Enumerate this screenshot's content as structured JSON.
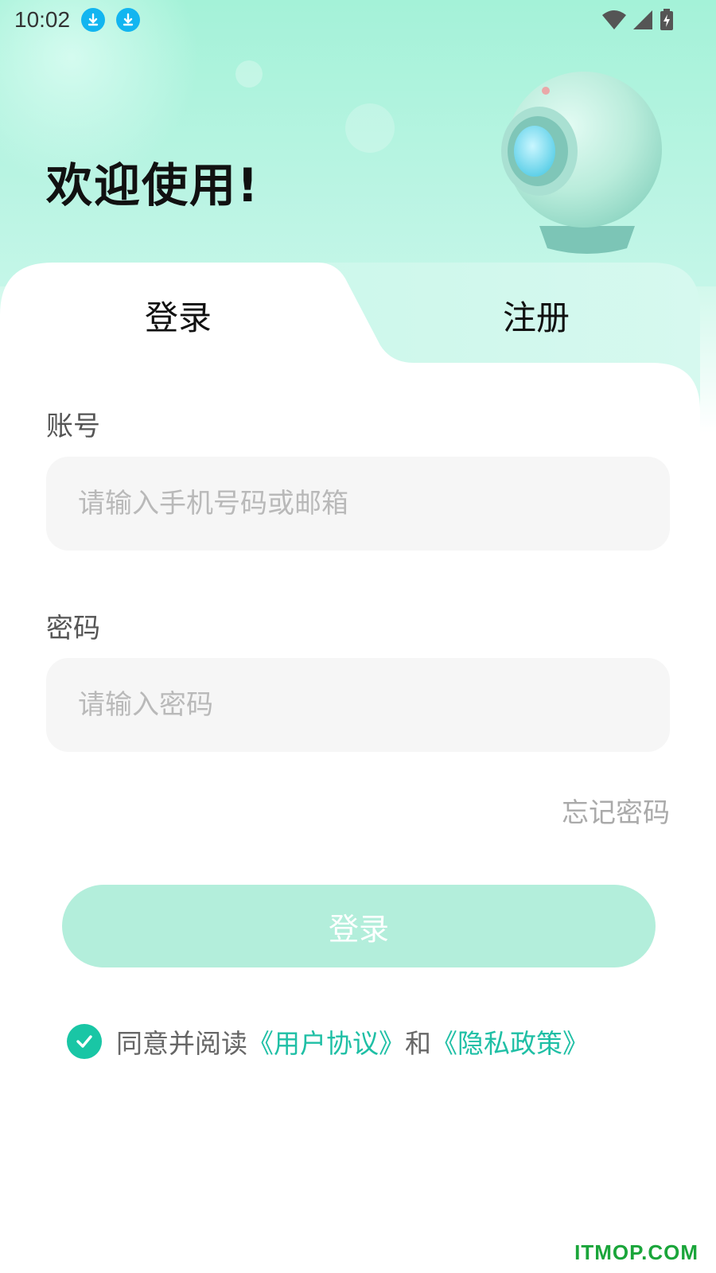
{
  "status_bar": {
    "time": "10:02",
    "icons": [
      "download-icon",
      "download-icon",
      "wifi-icon",
      "signal-icon",
      "battery-icon"
    ]
  },
  "header": {
    "welcome": "欢迎使用!"
  },
  "tabs": [
    {
      "label": "登录",
      "active": true
    },
    {
      "label": "注册",
      "active": false
    }
  ],
  "form": {
    "account_label": "账号",
    "account_placeholder": "请输入手机号码或邮箱",
    "password_label": "密码",
    "password_placeholder": "请输入密码",
    "forgot_label": "忘记密码",
    "submit_label": "登录"
  },
  "agreement": {
    "checked": true,
    "prefix": "同意并阅读",
    "user_agreement": "《用户协议》",
    "and": "和",
    "privacy_policy": "《隐私政策》"
  },
  "watermark": "ITMOP.COM",
  "colors": {
    "accent": "#19c6a5",
    "button_disabled": "#b3eedb",
    "header_mint": "#a4f2d8",
    "link": "#1fbfa5"
  }
}
